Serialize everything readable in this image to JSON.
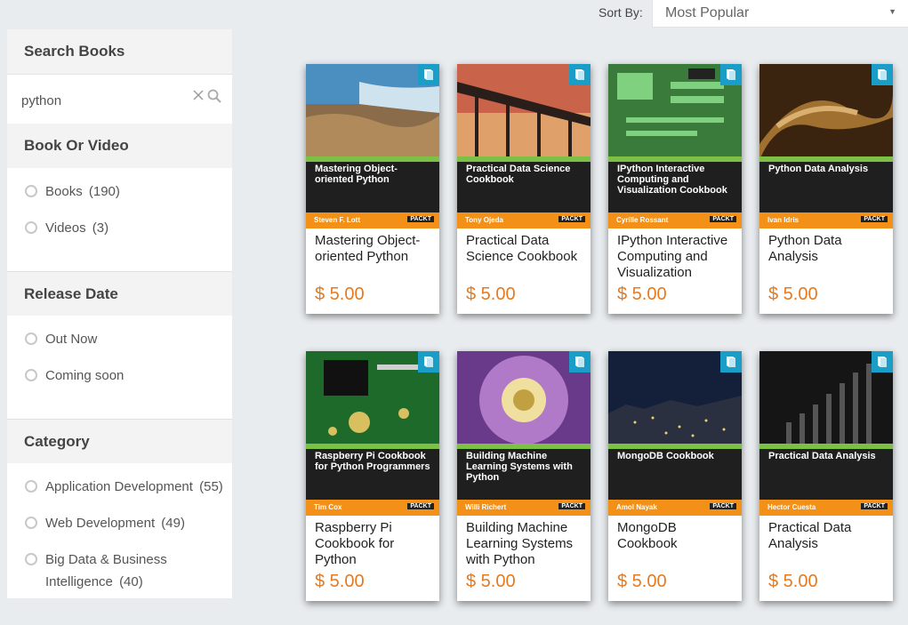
{
  "sort": {
    "label": "Sort By:",
    "selected": "Most Popular"
  },
  "sidebar": {
    "search": {
      "title": "Search Books",
      "value": "python"
    },
    "format": {
      "title": "Book Or Video",
      "options": [
        {
          "label": "Books",
          "count": "(190)"
        },
        {
          "label": "Videos",
          "count": "(3)"
        }
      ]
    },
    "release": {
      "title": "Release Date",
      "options": [
        {
          "label": "Out Now",
          "count": ""
        },
        {
          "label": "Coming soon",
          "count": ""
        }
      ]
    },
    "category": {
      "title": "Category",
      "options": [
        {
          "label": "Application Development",
          "count": "(55)"
        },
        {
          "label": "Web Development",
          "count": "(49)"
        },
        {
          "label": "Big Data & Business Intelligence",
          "count": "(40)"
        }
      ]
    }
  },
  "books": [
    {
      "title": "Mastering Object-oriented Python",
      "cover_title": "Mastering Object-oriented Python",
      "author": "Steven F. Lott",
      "price": "$ 5.00"
    },
    {
      "title": "Practical Data Science Cookbook",
      "cover_title": "Practical Data Science Cookbook",
      "author": "Tony Ojeda",
      "price": "$ 5.00"
    },
    {
      "title": "IPython Interactive Computing and Visualization",
      "cover_title": "IPython Interactive Computing and Visualization Cookbook",
      "author": "Cyrille Rossant",
      "price": "$ 5.00"
    },
    {
      "title": "Python Data Analysis",
      "cover_title": "Python Data Analysis",
      "author": "Ivan Idris",
      "price": "$ 5.00"
    },
    {
      "title": "Raspberry Pi Cookbook for Python",
      "cover_title": "Raspberry Pi Cookbook for Python Programmers",
      "author": "Tim Cox",
      "price": "$ 5.00"
    },
    {
      "title": "Building Machine Learning Systems with Python",
      "cover_title": "Building Machine Learning Systems with Python",
      "author": "Willi Richert",
      "price": "$ 5.00"
    },
    {
      "title": "MongoDB Cookbook",
      "cover_title": "MongoDB Cookbook",
      "author": "Amol Nayak",
      "price": "$ 5.00"
    },
    {
      "title": "Practical Data Analysis",
      "cover_title": "Practical Data Analysis",
      "author": "Hector Cuesta",
      "price": "$ 5.00"
    }
  ],
  "publisher_mark": "PACKT",
  "colors": {
    "price": "#e8791c",
    "badge": "#1a9ec8",
    "cover_bar": "#f29018",
    "cover_strip": "#7cc143"
  },
  "icons": {
    "badge": "book-icon",
    "clear": "close-icon",
    "search": "search-icon",
    "dropdown": "chevron-down-icon"
  }
}
